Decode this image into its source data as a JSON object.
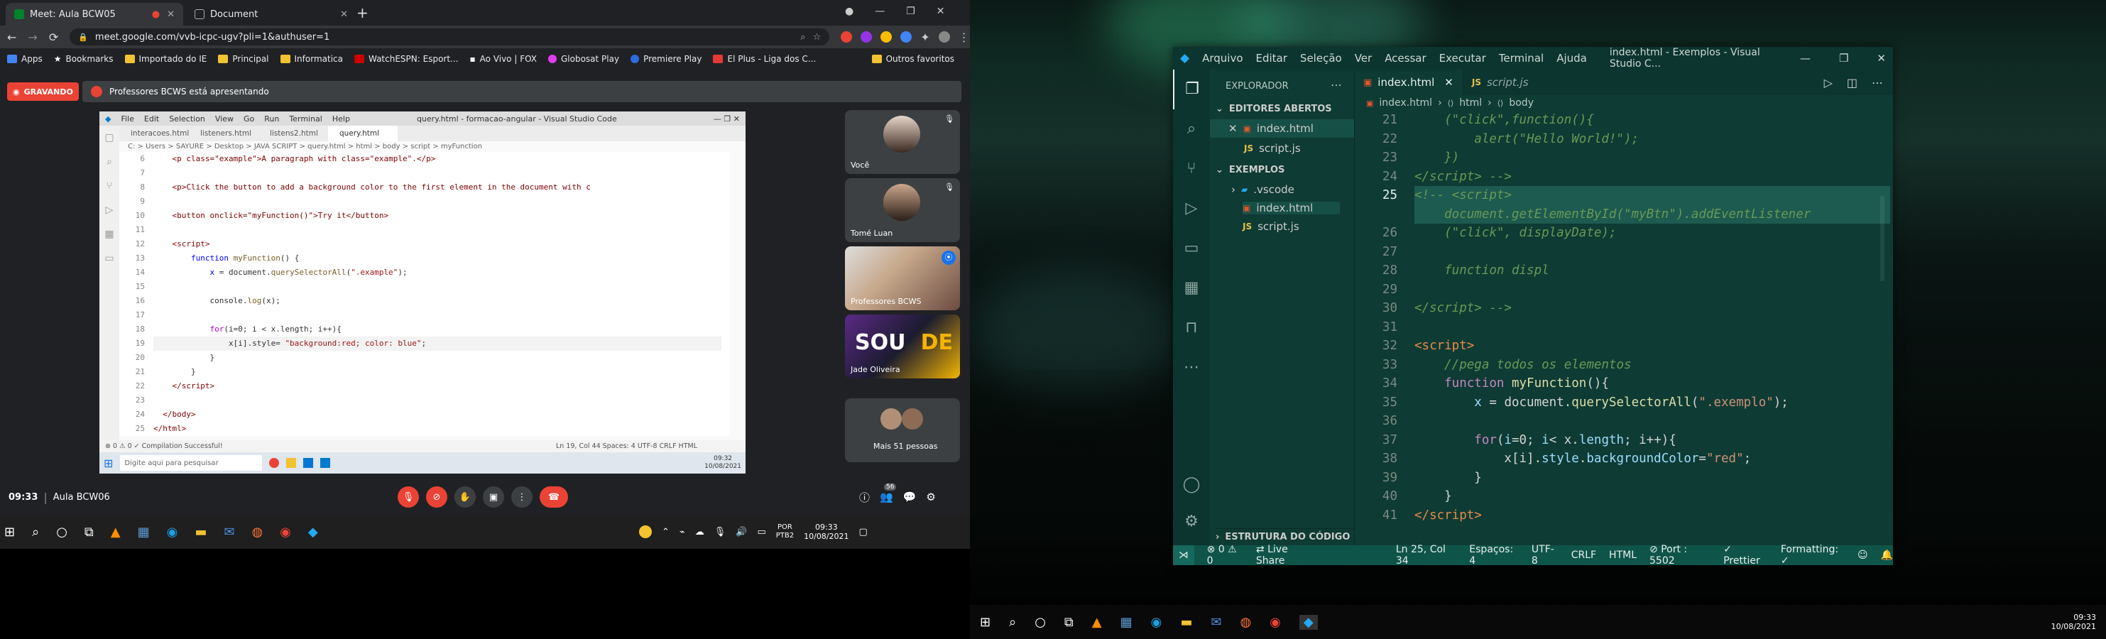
{
  "browser": {
    "tabs": [
      {
        "title": "Meet: Aula BCW05"
      },
      {
        "title": "Document"
      }
    ],
    "url": "meet.google.com/vvb-icpc-ugv?pli=1&authuser=1",
    "bookmarks": [
      "Apps",
      "Bookmarks",
      "Importado do IE",
      "Principal",
      "Informatica",
      "WatchESPN: Esport...",
      "Ao Vivo | FOX",
      "Globosat Play",
      "Premiere Play",
      "El Plus - Liga dos C..."
    ],
    "other_bookmarks": "Outros favoritos"
  },
  "meet": {
    "recording_label": "GRAVANDO",
    "presenting_label": "Professores BCWS está apresentando",
    "time": "09:33",
    "meeting_name": "Aula BCW06",
    "participants": [
      {
        "name": "Você"
      },
      {
        "name": "Tomé Luan"
      },
      {
        "name": "Professores BCWS"
      },
      {
        "name": "Jade Oliveira"
      }
    ],
    "more_people": "Mais 51 pessoas",
    "people_count": "56"
  },
  "shared_vscode": {
    "menu": [
      "File",
      "Edit",
      "Selection",
      "View",
      "Go",
      "Run",
      "Terminal",
      "Help"
    ],
    "title": "query.html - formacao-angular - Visual Studio Code",
    "tabs": [
      "interacoes.html",
      "listeners.html",
      "listens2.html",
      "query.html"
    ],
    "breadcrumb": "C: > Users > SAYURE > Desktop > JAVA SCRIPT > query.html > html > body > script > myFunction",
    "line_numbers": [
      "6",
      "7",
      "8",
      "9",
      "10",
      "11",
      "12",
      "13",
      "14",
      "15",
      "16",
      "17",
      "18",
      "19",
      "20",
      "21",
      "22",
      "23",
      "24",
      "25"
    ],
    "status_left": "⊗ 0 ⚠ 0    ✓ Compilation Successful!",
    "status_right": "Ln 19, Col 44    Spaces: 4    UTF-8    CRLF    HTML",
    "search_placeholder": "Digite aqui para pesquisar",
    "clock_time": "09:32",
    "clock_date": "10/08/2021"
  },
  "left_taskbar": {
    "lang1": "POR",
    "lang2": "PTB2",
    "time": "09:33",
    "date": "10/08/2021"
  },
  "vscode": {
    "menu": [
      "Arquivo",
      "Editar",
      "Seleção",
      "Ver",
      "Acessar",
      "Executar",
      "Terminal",
      "Ajuda"
    ],
    "title": "index.html - Exemplos - Visual Studio C...",
    "explorer_title": "EXPLORADOR",
    "open_editors_label": "EDITORES ABERTOS",
    "open_editors": [
      "index.html",
      "script.js"
    ],
    "folder_label": "EXEMPLOS",
    "folder_items": [
      ".vscode",
      "index.html",
      "script.js"
    ],
    "outline_label": "ESTRUTURA DO CÓDIGO",
    "tabs": [
      "index.html",
      "script.js"
    ],
    "breadcrumb": [
      "index.html",
      "html",
      "body"
    ],
    "line_numbers": [
      "21",
      "22",
      "23",
      "24",
      "25",
      "26",
      "27",
      "28",
      "29",
      "30",
      "31",
      "32",
      "33",
      "34",
      "35",
      "36",
      "37",
      "38",
      "39",
      "40",
      "41"
    ],
    "status": {
      "errors": "⊗ 0 ⚠ 0",
      "live_share": "Live Share",
      "position": "Ln 25, Col 34",
      "spaces": "Espaços: 4",
      "encoding": "UTF-8",
      "eol": "CRLF",
      "language": "HTML",
      "port": "Port : 5502",
      "prettier": "Prettier",
      "formatting": "Formatting: ✓"
    }
  },
  "right_taskbar": {
    "time": "09:33",
    "date": "10/08/2021"
  },
  "colors": {
    "meet_red": "#ea4335",
    "vscode_blue": "#007acc",
    "teal_status": "#0f5449"
  }
}
